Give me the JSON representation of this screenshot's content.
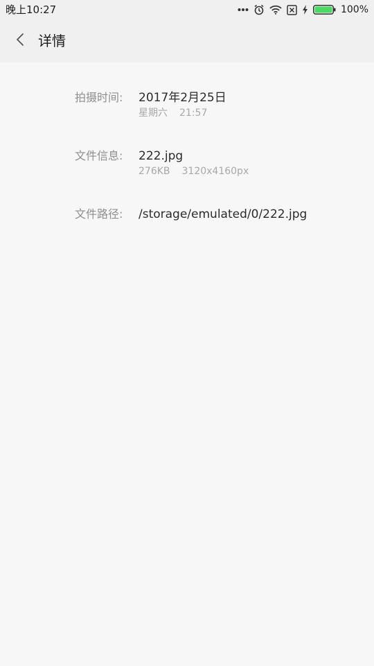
{
  "status_bar": {
    "time": "晚上10:27",
    "battery_percent": "100%",
    "icons": [
      "more-dots-icon",
      "alarm-clock-icon",
      "wifi-icon",
      "no-sim-icon",
      "charging-bolt-icon",
      "battery-icon"
    ],
    "battery_color": "#4cd964"
  },
  "header": {
    "back_icon": "chevron-left-icon",
    "title": "详情"
  },
  "details": {
    "capture_time": {
      "label": "拍摄时间:",
      "date": "2017年2月25日",
      "weekday": "星期六",
      "time": "21:57"
    },
    "file_info": {
      "label": "文件信息:",
      "name": "222.jpg",
      "size": "276KB",
      "resolution": "3120x4160px"
    },
    "file_path": {
      "label": "文件路径:",
      "path": "/storage/emulated/0/222.jpg"
    }
  }
}
